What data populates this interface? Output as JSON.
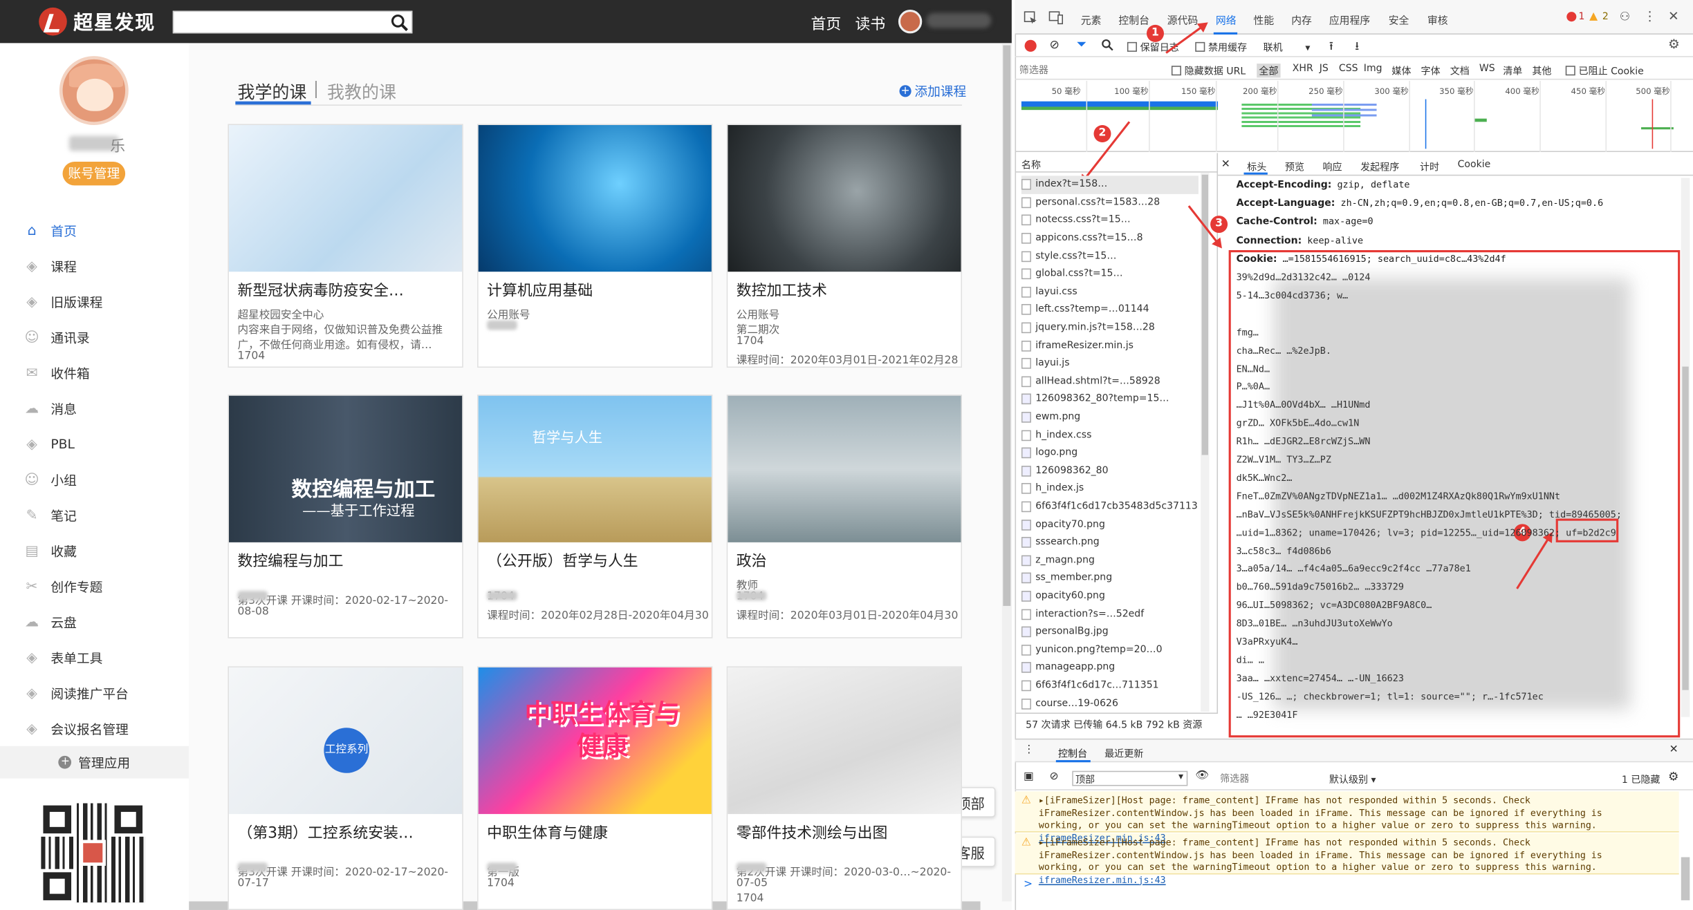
{
  "site": {
    "logo_text": "超星发现",
    "nav_home": "首页",
    "nav_read": "读书",
    "search_placeholder": ""
  },
  "profile": {
    "name_visible_suffix": "乐",
    "account_button": "账号管理"
  },
  "sidebar": {
    "items": [
      {
        "label": "首页",
        "icon": "home-icon",
        "active": true
      },
      {
        "label": "课程",
        "icon": "course-icon"
      },
      {
        "label": "旧版课程",
        "icon": "old-course-icon"
      },
      {
        "label": "通讯录",
        "icon": "contacts-icon"
      },
      {
        "label": "收件箱",
        "icon": "inbox-icon"
      },
      {
        "label": "消息",
        "icon": "message-icon"
      },
      {
        "label": "PBL",
        "icon": "pbl-icon"
      },
      {
        "label": "小组",
        "icon": "group-icon"
      },
      {
        "label": "笔记",
        "icon": "note-icon"
      },
      {
        "label": "收藏",
        "icon": "favorite-icon"
      },
      {
        "label": "创作专题",
        "icon": "create-icon"
      },
      {
        "label": "云盘",
        "icon": "cloud-icon"
      },
      {
        "label": "表单工具",
        "icon": "form-icon"
      },
      {
        "label": "阅读推广平台",
        "icon": "reading-icon"
      },
      {
        "label": "会议报名管理",
        "icon": "meeting-icon"
      }
    ],
    "manage_apps": "管理应用"
  },
  "main": {
    "tab_learn": "我学的课",
    "tab_sep": "|",
    "tab_teach": "我教的课",
    "add_course": "添加课程",
    "courses": [
      {
        "title": "新型冠状病毒防疫安全…",
        "lines": [
          "超星校园安全中心",
          "内容来自于网络，仅做知识普及免费公益推",
          "广，不做任何商业用途。如有侵权，请…",
          "1704"
        ]
      },
      {
        "title": "计算机应用基础",
        "lines": [
          "公用账号",
          "",
          "",
          ""
        ]
      },
      {
        "title": "数控加工技术",
        "lines": [
          "公用账号",
          "第二期次",
          "1704",
          "课程时间：2020年03月01日-2021年02月28日"
        ]
      },
      {
        "title": "数控编程与加工",
        "lines": [
          "",
          "第3次开课   开课时间：2020-02-17~2020-",
          "08-08",
          ""
        ],
        "img_title": "数控编程与加工",
        "img_subtitle": "——基于工作过程"
      },
      {
        "title": "（公开版）哲学与人生",
        "lines": [
          "",
          "1704",
          "课程时间：2020年02月28日-2020年04月30日",
          ""
        ],
        "img_title": "哲学与人生"
      },
      {
        "title": "政治",
        "lines": [
          "教师",
          "1704",
          "课程时间：2020年03月01日-2020年04月30日",
          ""
        ]
      },
      {
        "title": "（第3期）工控系统安装…",
        "lines": [
          "",
          "第3次开课   开课时间：2020-02-17~2020-",
          "07-17",
          ""
        ],
        "img_title": "工控系列"
      },
      {
        "title": "中职生体育与健康",
        "lines": [
          "",
          "第一版",
          "1704",
          ""
        ],
        "img_title": "中职生体育与健康"
      },
      {
        "title": "零部件技术测绘与出图",
        "lines": [
          "",
          "第2次开课   开课时间：2020-03-0…~2020-",
          "07-05",
          "1704"
        ]
      }
    ],
    "float_top": "返回顶部",
    "float_service": "在线客服"
  },
  "devtools": {
    "tabs": [
      "元素",
      "控制台",
      "源代码",
      "网络",
      "性能",
      "内存",
      "应用程序",
      "安全",
      "审核"
    ],
    "selected_tab": "网络",
    "error_count": "1",
    "warning_count": "2",
    "toolbar": {
      "preserve_log": "保留日志",
      "disable_cache": "禁用缓存",
      "throttle": "联机"
    },
    "filter": {
      "placeholder": "筛选器",
      "hide_data_url": "隐藏数据 URL",
      "types": [
        "全部",
        "XHR",
        "JS",
        "CSS",
        "Img",
        "媒体",
        "字体",
        "文档",
        "WS",
        "清单",
        "其他"
      ],
      "blocked_cookies": "已阻止 Cookie"
    },
    "timeline_ticks": [
      "50 毫秒",
      "100 毫秒",
      "150 毫秒",
      "200 毫秒",
      "250 毫秒",
      "300 毫秒",
      "350 毫秒",
      "400 毫秒",
      "450 毫秒",
      "500 毫秒"
    ],
    "name_header": "名称",
    "requests": [
      "index?t=158…",
      "personal.css?t=1583…28",
      "notecss.css?t=15…",
      "appicons.css?t=15…8",
      "style.css?t=15…",
      "global.css?t=15…",
      "layui.css",
      "left.css?temp=…01144",
      "jquery.min.js?t=158…28",
      "iframeResizer.min.js",
      "layui.js",
      "allHead.shtml?t=…58928",
      "126098362_80?temp=15…",
      "ewm.png",
      "h_index.css",
      "logo.png",
      "126098362_80",
      "h_index.js",
      "6f63f4f1c6d17cb35483d5c3711351",
      "opacity70.png",
      "sssearch.png",
      "z_magn.png",
      "ss_member.png",
      "opacity60.png",
      "interaction?s=…52edf",
      "personalBg.jpg",
      "yunicon.png?temp=20…0",
      "manageapp.png",
      "6f63f4f1c6d17c…711351",
      "course…19-0626"
    ],
    "summary": "57 次请求  已传输 64.5 kB  792 kB 资源",
    "detail_tabs": [
      "标头",
      "预览",
      "响应",
      "发起程序",
      "计时",
      "Cookie"
    ],
    "headers": [
      {
        "k": "Accept-Encoding:",
        "v": " gzip, deflate"
      },
      {
        "k": "Accept-Language:",
        "v": " zh-CN,zh;q=0.9,en;q=0.8,en-GB;q=0.7,en-US;q=0.6"
      },
      {
        "k": "Cache-Control:",
        "v": " max-age=0"
      },
      {
        "k": "Connection:",
        "v": " keep-alive"
      },
      {
        "k": "Cookie:",
        "v": " …=1581554616915; search_uuid=c8c…43%2d4f"
      }
    ],
    "cookie_lines": [
      "39%2d9d…2d3132c42…                              …0124",
      "5-14…3c004cd3736; w…",
      "",
      "fmg…",
      "cha…Rec…                   …%2eJpB.",
      "EN…Nd…",
      "P…%0A…",
      "…J1t%0A…0OVd4bX…                                    …H1UNmd",
      "grZD…                                       XOFk5bE…4do…cw1N",
      "R1h…                                        …dEJGR2…E8rcWZjS…WN",
      "Z2W…V1M…                                         TY3…Z…PZ",
      "dk5K…Wnc2…",
      "FneT…0ZmZV%0ANgzTDVpNEZ1a1…             …d002M1Z4RXAzQk80Q1RwYm9xU1NNt",
      "…nBaV…VJsSE5k%0ANHFrejkKSUFZPT9hcHBJZD0xJmtleU1kPTE%3D;  tid=89465005;",
      "…uid=1…8362; uname=170426; lv=3; pid=12255…_uid=126098362; uf=b2d2c9",
      "3…c58c3…                                                f4d086b6",
      "3…a05a/14…              …f4c4a05…6a9ecc9c2f4cc     …77a78e1",
      "b0…760…591da9c75016b2…                                  …333729",
      "96…UI…5098362; vc=A3DC080A2BF9A8C0…",
      "8D3…01BE…                       …n3uhdJU3utoXeWwYo",
      "V3aPRxyuK4…",
      "di…                                                      …",
      "3aa…             …xxtenc=27454…                     …-UN_16623",
      "-US_126…                  …; checkbrower=1; tl=1: source=\"\"; r…-1fc571ec",
      "…                                                          …92E3041F"
    ],
    "console": {
      "tab_console": "控制台",
      "tab_recent": "最近更新",
      "context": "顶部",
      "filter_placeholder": "筛选器",
      "level": "默认级别",
      "hidden_count": "1 已隐藏",
      "warnings": [
        {
          "text": "▸[iFrameSizer][Host page: frame_content] IFrame has not responded within 5 seconds. Check iFrameResizer.contentWindow.js has been loaded in iFrame. This message can be ignored if everything is working, or you can set the warningTimeout option to a higher value or zero to suppress this warning.",
          "link": "iframeResizer.min.js:43"
        },
        {
          "text": "▸[iFrameSizer][Host page: frame_content] IFrame has not responded within 5 seconds. Check iFrameResizer.contentWindow.js has been loaded in iFrame. This message can be ignored if everything is working, or you can set the warningTimeout option to a higher value or zero to suppress this warning.",
          "link": "iframeResizer.min.js:43"
        }
      ],
      "prompt": ">"
    }
  },
  "annotations": [
    "1",
    "2",
    "3",
    "4"
  ]
}
